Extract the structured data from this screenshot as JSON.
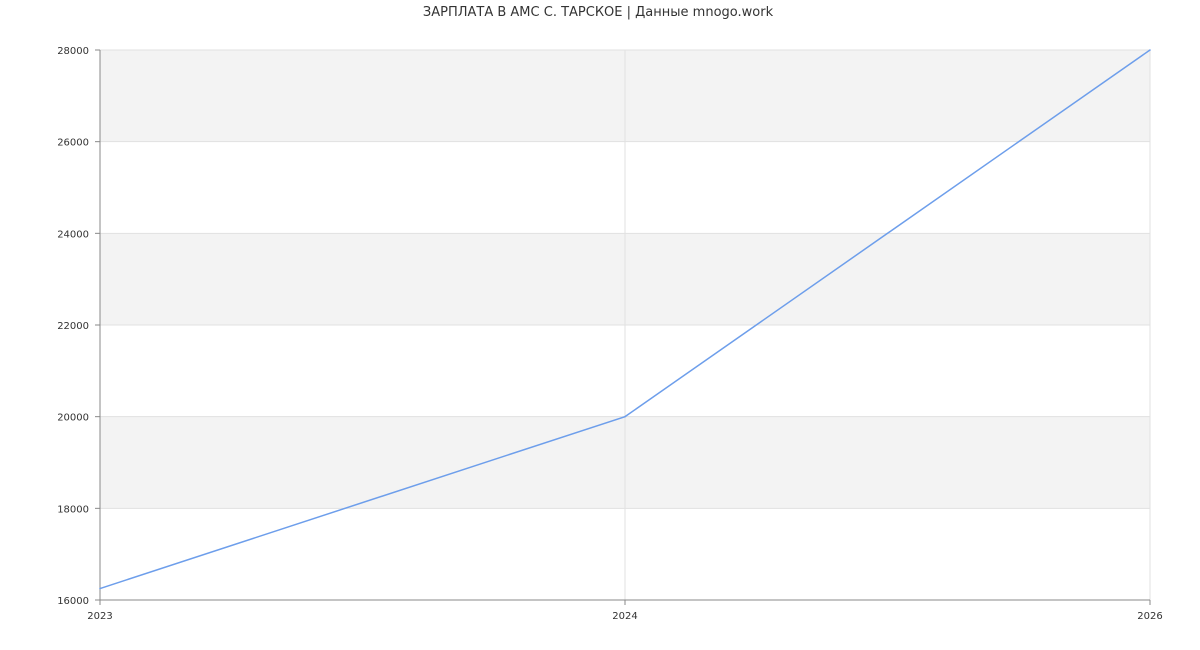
{
  "chart_data": {
    "type": "line",
    "title": "ЗАРПЛАТА В АМС С. ТАРСКОЕ | Данные mnogo.work",
    "xlabel": "",
    "ylabel": "",
    "x_ticks": [
      "2023",
      "2024",
      "2026"
    ],
    "y_ticks": [
      "16000",
      "18000",
      "20000",
      "22000",
      "24000",
      "26000",
      "28000"
    ],
    "ylim": [
      16000,
      28000
    ],
    "grid": true,
    "series": [
      {
        "x": [
          "2023",
          "2024",
          "2026"
        ],
        "values": [
          16250,
          20000,
          28000
        ]
      }
    ],
    "colors": {
      "line": "#6d9eeb",
      "band": "#f3f3f3",
      "grid": "#e1e1e1",
      "axis": "#888888",
      "text": "#333333"
    }
  }
}
